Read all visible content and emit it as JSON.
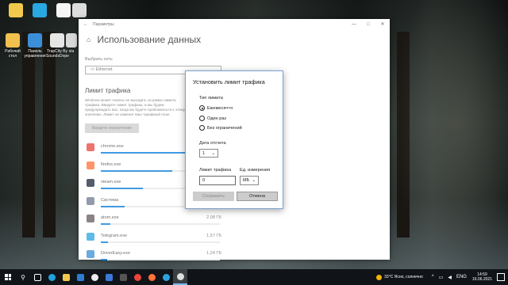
{
  "desktop": {
    "icons": [
      {
        "label": "",
        "color": "#f2c94c"
      },
      {
        "label": "",
        "color": "#29a9e1"
      },
      {
        "label": "",
        "color": "#f5f5f5"
      },
      {
        "label": "Рабочий стол",
        "color": "#f2c14e"
      },
      {
        "label": "Панель управления",
        "color": "#3b8fd9"
      },
      {
        "label": "TrapCity By SoundsDope",
        "color": "#e6e6e6"
      },
      {
        "label": "sta",
        "color": "#d9d9d9"
      }
    ]
  },
  "settings": {
    "window_title": "Параметры",
    "back_glyph": "←",
    "min_glyph": "—",
    "max_glyph": "□",
    "close_glyph": "✕",
    "home_glyph": "⌂",
    "page_title": "Использование данных",
    "select_network_label": "Выбрать сеть",
    "network_value": "Ethernet",
    "traffic_limit_title": "Лимит трафика",
    "description": "Windows может помочь не выходить за рамки лимита трафика. Введите лимит трафика, и мы будем предупреждать вас, когда вы будете приближаться к этому значению. Лимит не изменит ваш тарифный план.",
    "enter_limit_button": "Введите ограничение",
    "apps": [
      {
        "name": "chrome.exe",
        "usage": "",
        "fraction": 0.95,
        "color": "#e8453c"
      },
      {
        "name": "firefox.exe",
        "usage": "",
        "fraction": 0.6,
        "color": "#ff7139"
      },
      {
        "name": "steam.exe",
        "usage": "",
        "fraction": 0.35,
        "color": "#1b2838"
      },
      {
        "name": "Система",
        "usage": "",
        "fraction": 0.2,
        "color": "#6b7a8f"
      },
      {
        "name": "atom.exe",
        "usage": "2,08 ГБ",
        "fraction": 0.08,
        "color": "#66595c"
      },
      {
        "name": "Telegram.exe",
        "usage": "1,57 ГБ",
        "fraction": 0.06,
        "color": "#2aa3e0"
      },
      {
        "name": "DriverEasy.exe",
        "usage": "1,24 ГБ",
        "fraction": 0.05,
        "color": "#3a8fd6"
      }
    ]
  },
  "dialog": {
    "title": "Установить лимит трафика",
    "limit_type_label": "Тип лимита",
    "options": [
      "Ежемесячно",
      "Один раз",
      "Без ограничений"
    ],
    "selected_option": "Ежемесячно",
    "reset_date_label": "Дата отсчета",
    "reset_date_value": "1",
    "traffic_limit_label": "Лимит трафика",
    "traffic_limit_value": "0",
    "unit_label": "Ед. измерения",
    "unit_value": "МБ",
    "save_button": "Сохранить",
    "cancel_button": "Отмена",
    "chevron": "⌄"
  },
  "taskbar": {
    "weather": "33°C Ясно, солнечно",
    "language": "ENG",
    "time": "14:59",
    "date": "16.06.2021",
    "search_glyph": "⚲",
    "chevron_glyph": "^"
  }
}
